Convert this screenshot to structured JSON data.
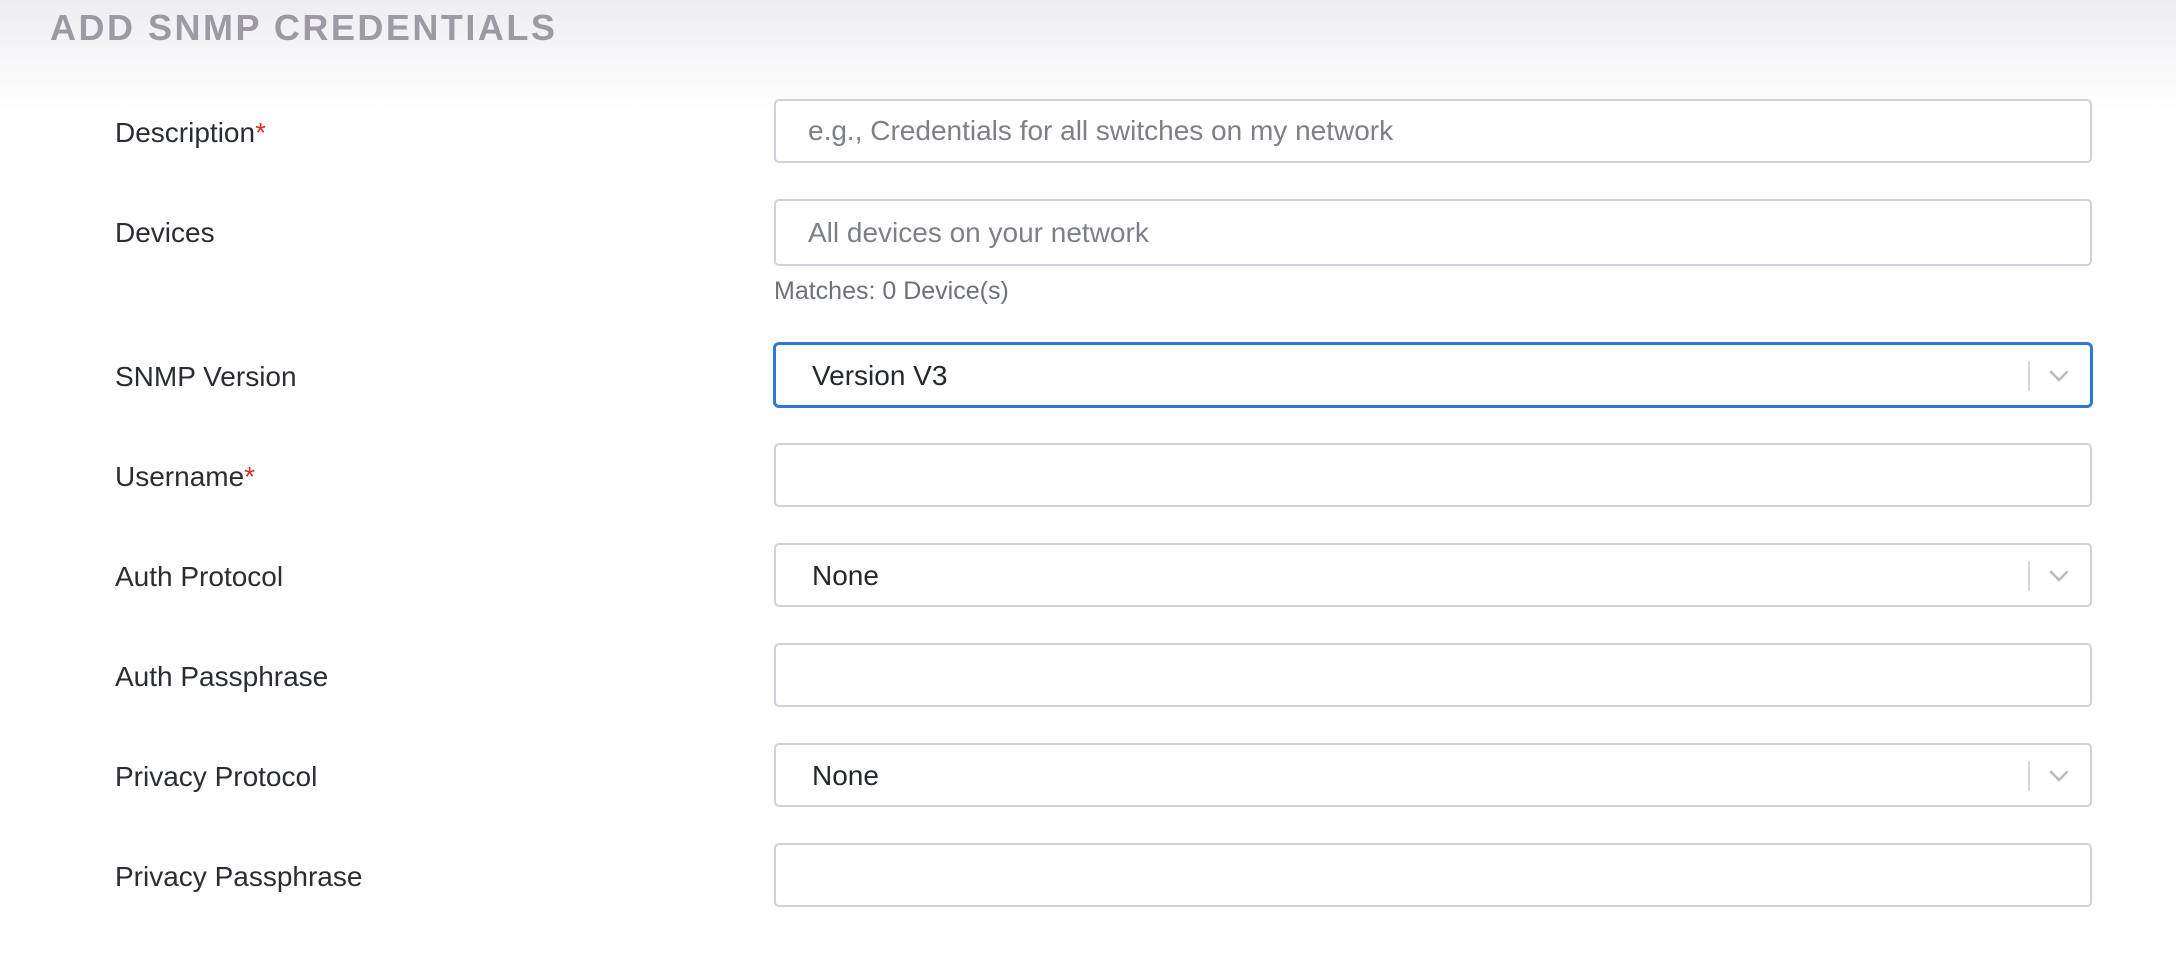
{
  "header": {
    "title": "ADD SNMP CREDENTIALS"
  },
  "form": {
    "description": {
      "label": "Description",
      "required_mark": "*",
      "placeholder": "e.g., Credentials for all switches on my network",
      "value": ""
    },
    "devices": {
      "label": "Devices",
      "placeholder": "All devices on your network",
      "value": "",
      "matches_text": "Matches: 0 Device(s)"
    },
    "snmp_version": {
      "label": "SNMP Version",
      "selected": "Version V3"
    },
    "username": {
      "label": "Username",
      "required_mark": "*",
      "value": ""
    },
    "auth_protocol": {
      "label": "Auth Protocol",
      "selected": "None"
    },
    "auth_passphrase": {
      "label": "Auth Passphrase",
      "value": ""
    },
    "privacy_protocol": {
      "label": "Privacy Protocol",
      "selected": "None"
    },
    "privacy_passphrase": {
      "label": "Privacy Passphrase",
      "value": ""
    }
  },
  "icons": {
    "dropdown": "chevron-down-icon"
  },
  "colors": {
    "required": "#d0312d",
    "focus_border": "#2d7ad6",
    "field_border": "#cfd2de",
    "header_text": "#9e9aa4"
  }
}
